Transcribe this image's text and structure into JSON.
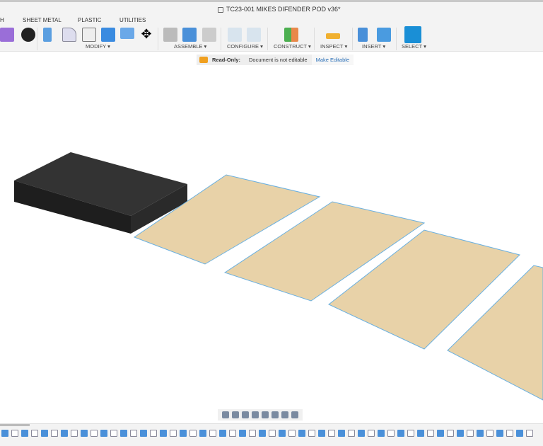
{
  "window": {
    "title": "TC23-001 MIKES DIFENDER POD v36*"
  },
  "tabs": [
    "H",
    "SHEET METAL",
    "PLASTIC",
    "UTILITIES"
  ],
  "groups": [
    "MODIFY ▾",
    "ASSEMBLE ▾",
    "CONFIGURE ▾",
    "CONSTRUCT ▾",
    "INSPECT ▾",
    "INSERT ▾",
    "SELECT ▾"
  ],
  "banner": {
    "label": "Read-Only:",
    "message": "Document is not editable",
    "action": "Make Editable"
  },
  "colors": {
    "accent": "#1a8fd6",
    "wood": "#e8d2a8",
    "dark": "#2a2a2a"
  }
}
